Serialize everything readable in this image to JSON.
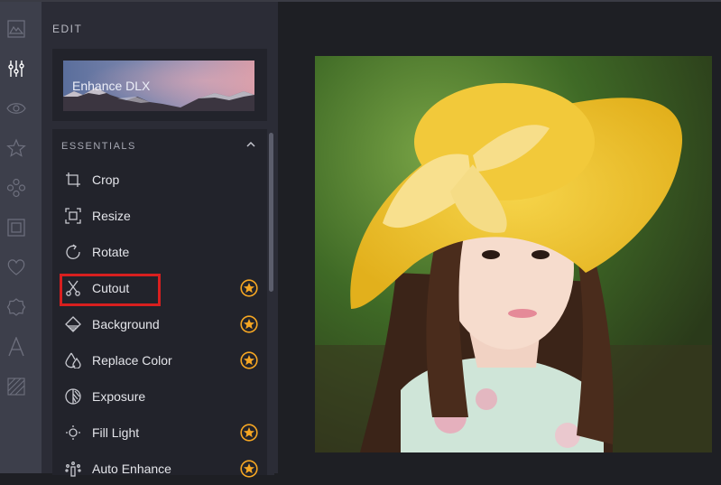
{
  "app": {
    "accent_color": "#f5a623",
    "highlight_color": "#d81f1f"
  },
  "rail": {
    "items": [
      {
        "id": "image",
        "icon": "mountain-image-icon",
        "active": false
      },
      {
        "id": "edit",
        "icon": "sliders-icon",
        "active": true
      },
      {
        "id": "view",
        "icon": "eye-icon",
        "active": false
      },
      {
        "id": "favorites",
        "icon": "star-icon",
        "active": false
      },
      {
        "id": "effects",
        "icon": "circles-icon",
        "active": false
      },
      {
        "id": "frames",
        "icon": "frame-icon",
        "active": false
      },
      {
        "id": "overlays",
        "icon": "heart-icon",
        "active": false
      },
      {
        "id": "stickers",
        "icon": "badge-icon",
        "active": false
      },
      {
        "id": "text",
        "icon": "text-a-icon",
        "active": false
      },
      {
        "id": "textures",
        "icon": "texture-icon",
        "active": false
      }
    ]
  },
  "panel": {
    "title": "EDIT",
    "promo": {
      "label": "Enhance DLX"
    },
    "section": {
      "title": "ESSENTIALS",
      "expanded": true,
      "tools": [
        {
          "label": "Crop",
          "icon": "crop-icon",
          "premium": false
        },
        {
          "label": "Resize",
          "icon": "resize-icon",
          "premium": false
        },
        {
          "label": "Rotate",
          "icon": "rotate-icon",
          "premium": false
        },
        {
          "label": "Cutout",
          "icon": "scissors-icon",
          "premium": true,
          "highlighted": true
        },
        {
          "label": "Background",
          "icon": "background-icon",
          "premium": true
        },
        {
          "label": "Replace Color",
          "icon": "drops-icon",
          "premium": true
        },
        {
          "label": "Exposure",
          "icon": "exposure-icon",
          "premium": false
        },
        {
          "label": "Fill Light",
          "icon": "sun-icon",
          "premium": true
        },
        {
          "label": "Auto Enhance",
          "icon": "magic-icon",
          "premium": true
        }
      ]
    }
  },
  "canvas": {
    "image_description": "Portrait of a woman wearing a yellow sun hat against green foliage"
  }
}
